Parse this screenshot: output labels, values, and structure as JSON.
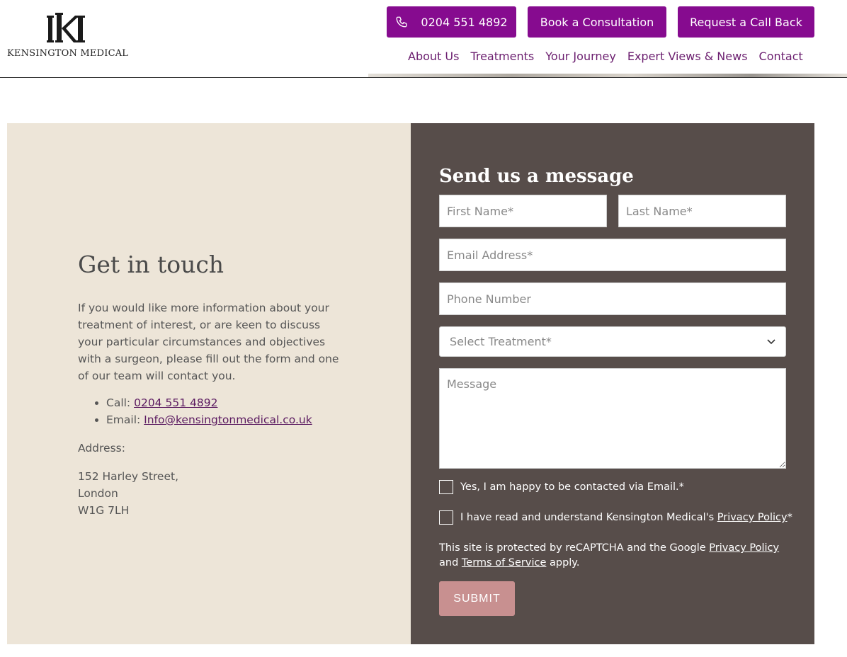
{
  "brand": {
    "name": "KENSINGTON MEDICAL"
  },
  "header": {
    "phone_label": "0204 551 4892",
    "consult_label": "Book a Consultation",
    "callback_label": "Request a Call Back"
  },
  "nav": {
    "items": [
      "About Us",
      "Treatments",
      "Your Journey",
      "Expert Views & News",
      "Contact"
    ]
  },
  "contact_info": {
    "title": "Get in touch",
    "paragraph": "If you would like more information about your treatment of interest, or are keen to discuss your particular circumstances and objectives with a surgeon, please fill out the form and one of our team will contact you.",
    "call_prefix": "Call: ",
    "call_value": "0204 551 4892",
    "email_prefix": "Email: ",
    "email_value": "Info@kensingtonmedical.co.uk",
    "address_label": "Address:",
    "address_lines": [
      "152 Harley Street,",
      "London",
      "W1G 7LH"
    ]
  },
  "form": {
    "title": "Send us a message",
    "first_name_placeholder": "First Name*",
    "last_name_placeholder": "Last Name*",
    "email_placeholder": "Email Address*",
    "phone_placeholder": "Phone Number",
    "treatment_selected": "Select Treatment*",
    "message_placeholder": "Message",
    "consent_email": "Yes, I am happy to be contacted via Email.*",
    "consent_privacy_prefix": "I have read and understand Kensington Medical's ",
    "consent_privacy_link": "Privacy Policy",
    "consent_privacy_suffix": "*",
    "recaptcha_prefix": "This site is protected by reCAPTCHA and the Google ",
    "recaptcha_privacy": "Privacy Policy",
    "recaptcha_and": " and ",
    "recaptcha_terms": "Terms of Service",
    "recaptcha_suffix": " apply.",
    "submit_label": "SUBMIT"
  },
  "colors": {
    "brand_purple": "#860b8f",
    "nav_purple": "#6b1e6f",
    "beige_panel": "#ede5d8",
    "form_panel": "#574d4a",
    "submit_pink": "#c89090"
  }
}
